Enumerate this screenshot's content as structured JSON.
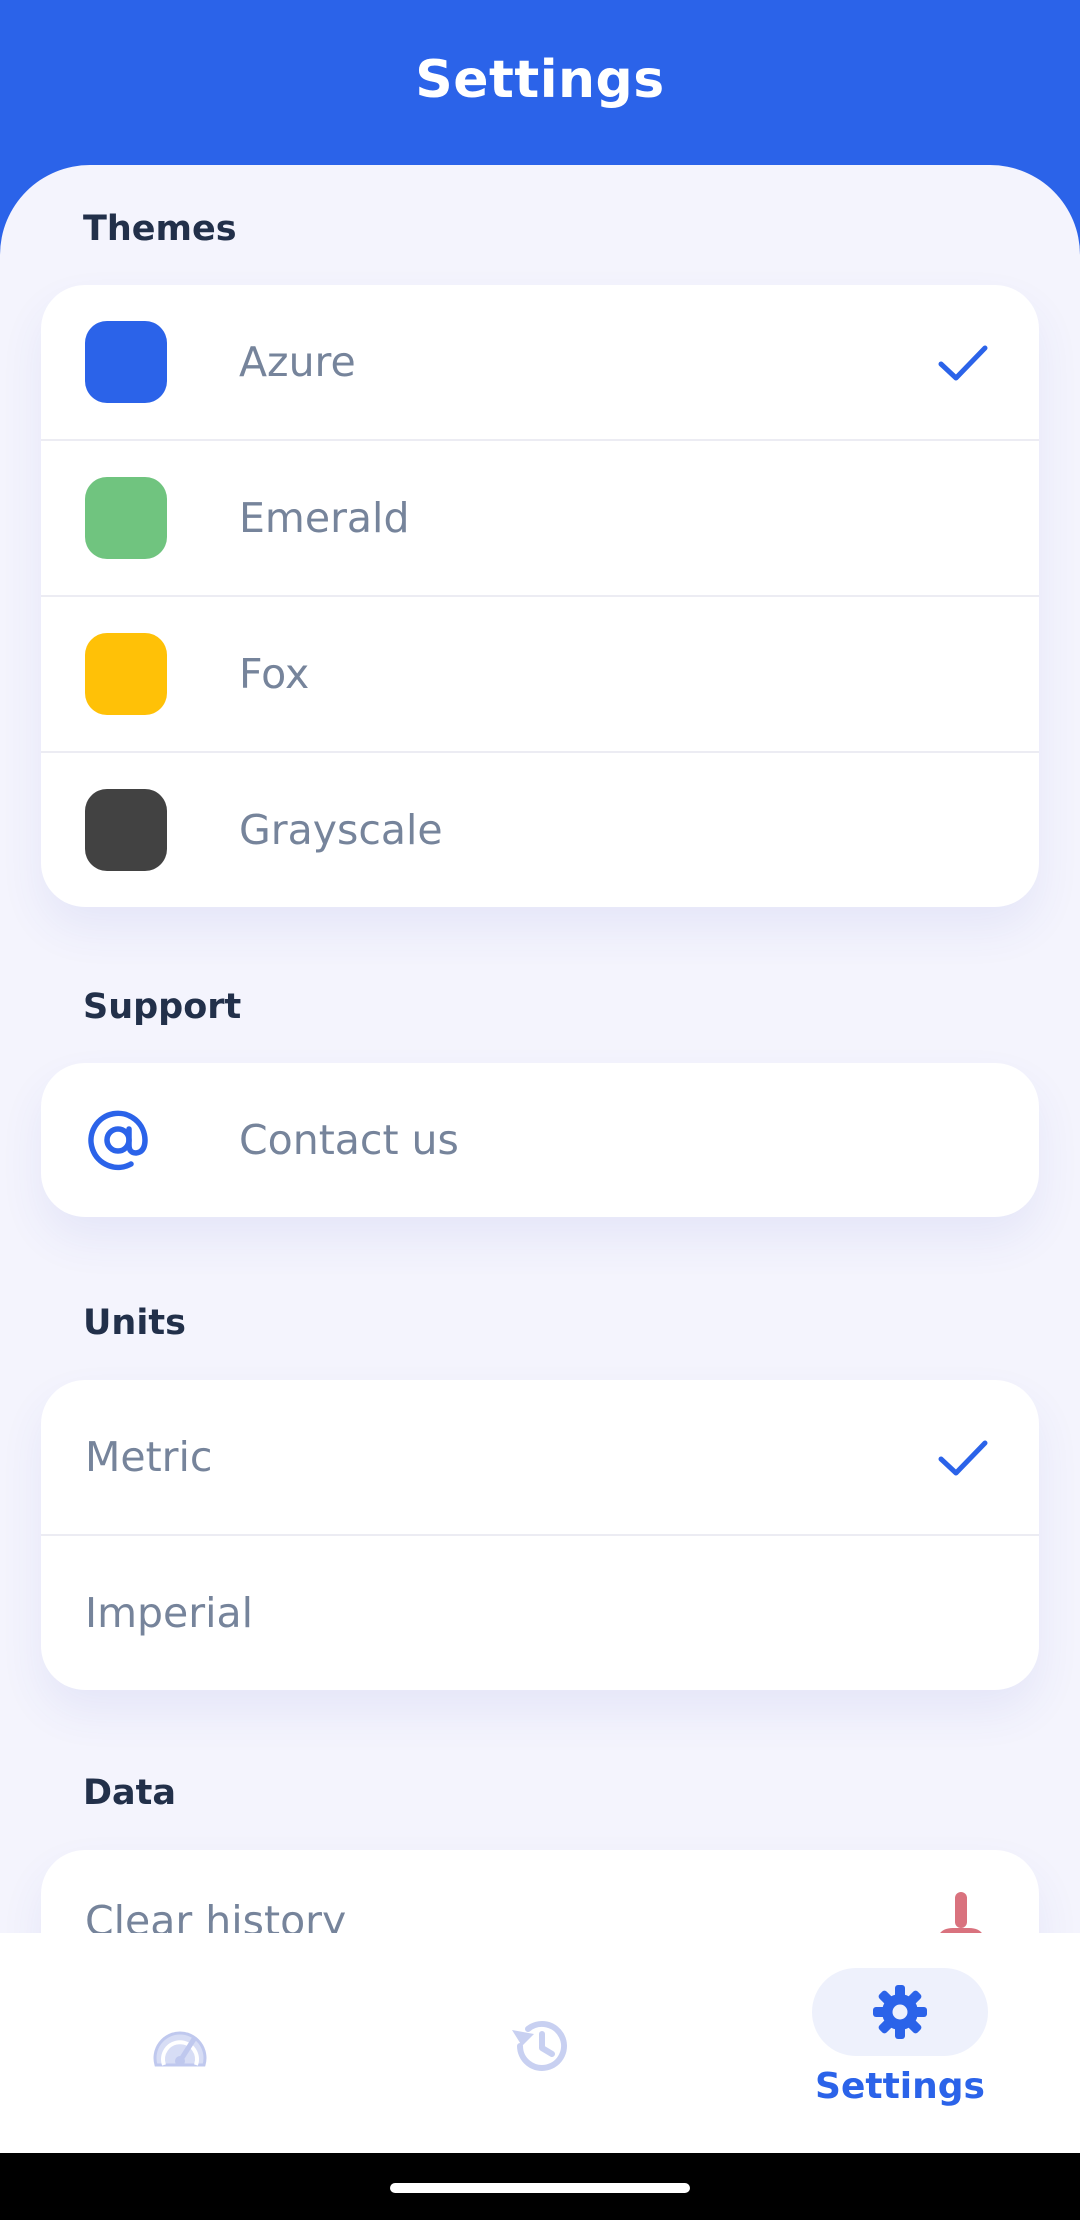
{
  "header": {
    "title": "Settings"
  },
  "sections": {
    "themes": {
      "title": "Themes",
      "items": [
        {
          "label": "Azure",
          "color": "#2b63e9",
          "selected": true
        },
        {
          "label": "Emerald",
          "color": "#70c47f",
          "selected": false
        },
        {
          "label": "Fox",
          "color": "#ffc107",
          "selected": false
        },
        {
          "label": "Grayscale",
          "color": "#424242",
          "selected": false
        }
      ]
    },
    "support": {
      "title": "Support",
      "items": [
        {
          "label": "Contact us",
          "icon": "at-icon"
        }
      ]
    },
    "units": {
      "title": "Units",
      "items": [
        {
          "label": "Metric",
          "selected": true
        },
        {
          "label": "Imperial",
          "selected": false
        }
      ]
    },
    "data": {
      "title": "Data",
      "items": [
        {
          "label": "Clear history",
          "icon": "brush-icon"
        }
      ]
    }
  },
  "bottom_nav": {
    "items": [
      {
        "icon": "speedometer-icon",
        "active": false
      },
      {
        "icon": "history-icon",
        "active": false
      },
      {
        "icon": "gear-icon",
        "label": "Settings",
        "active": true
      }
    ]
  },
  "colors": {
    "accent": "#2b63e9",
    "background": "#f4f4fd",
    "text_muted": "#76849b",
    "danger": "#d9727e"
  }
}
